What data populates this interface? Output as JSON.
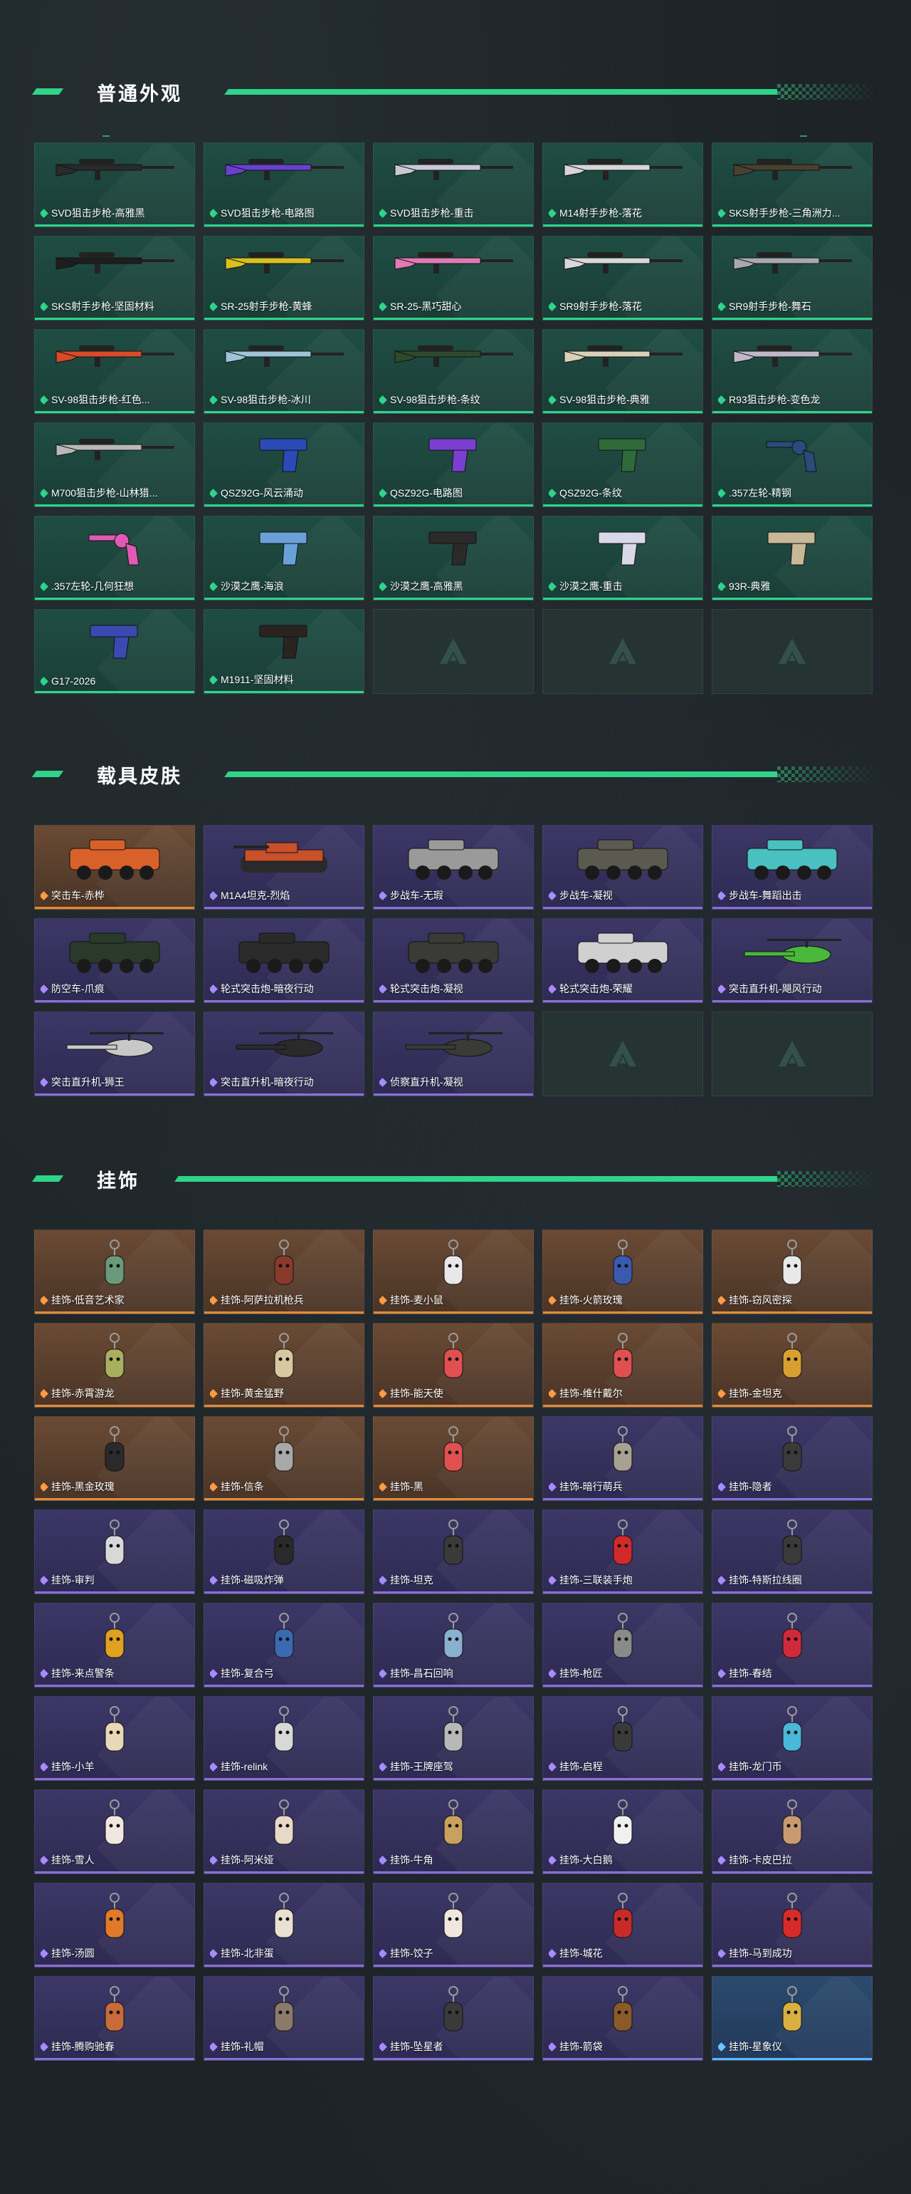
{
  "sections": {
    "weapons": {
      "title": "普通外观",
      "items": [
        {
          "label": "SVD狙击步枪-高雅黑",
          "rarity": "green",
          "kind": "rifle",
          "color": "#2a2a2a"
        },
        {
          "label": "SVD狙击步枪-电路图",
          "rarity": "green",
          "kind": "rifle",
          "color": "#6a3fd0"
        },
        {
          "label": "SVD狙击步枪-重击",
          "rarity": "green",
          "kind": "rifle",
          "color": "#c9c9d6"
        },
        {
          "label": "M14射手步枪-落花",
          "rarity": "green",
          "kind": "rifle",
          "color": "#d6d6d6"
        },
        {
          "label": "SKS射手步枪-三角洲力...",
          "rarity": "green",
          "kind": "rifle",
          "color": "#4a4030"
        },
        {
          "label": "SKS射手步枪-坚固材料",
          "rarity": "green",
          "kind": "rifle",
          "color": "#1e1e1e"
        },
        {
          "label": "SR-25射手步枪-黄蜂",
          "rarity": "green",
          "kind": "rifle",
          "color": "#d8c020"
        },
        {
          "label": "SR-25-黑巧甜心",
          "rarity": "green",
          "kind": "rifle",
          "color": "#e07ab5"
        },
        {
          "label": "SR9射手步枪-落花",
          "rarity": "green",
          "kind": "rifle",
          "color": "#d8d8d8"
        },
        {
          "label": "SR9射手步枪-舞石",
          "rarity": "green",
          "kind": "rifle",
          "color": "#a8a8b0"
        },
        {
          "label": "SV-98狙击步枪-红色...",
          "rarity": "green",
          "kind": "rifle",
          "color": "#d84a2a"
        },
        {
          "label": "SV-98狙击步枪-冰川",
          "rarity": "green",
          "kind": "rifle",
          "color": "#9ec4d8"
        },
        {
          "label": "SV-98狙击步枪-条纹",
          "rarity": "green",
          "kind": "rifle",
          "color": "#2e4a2e"
        },
        {
          "label": "SV-98狙击步枪-典雅",
          "rarity": "green",
          "kind": "rifle",
          "color": "#d8d0b8"
        },
        {
          "label": "R93狙击步枪-变色龙",
          "rarity": "green",
          "kind": "rifle",
          "color": "#c0b8c8"
        },
        {
          "label": "M700狙击步枪-山林猎...",
          "rarity": "green",
          "kind": "rifle",
          "color": "#b8b8b8"
        },
        {
          "label": "QSZ92G-风云涌动",
          "rarity": "green",
          "kind": "pistol",
          "color": "#2a4ab8"
        },
        {
          "label": "QSZ92G-电路图",
          "rarity": "green",
          "kind": "pistol",
          "color": "#7a3fd0"
        },
        {
          "label": "QSZ92G-条纹",
          "rarity": "green",
          "kind": "pistol",
          "color": "#2e6a3a"
        },
        {
          "label": ".357左轮-精钢",
          "rarity": "green",
          "kind": "revolver",
          "color": "#2a4a7a"
        },
        {
          "label": ".357左轮-几何狂想",
          "rarity": "green",
          "kind": "revolver",
          "color": "#e05ab5"
        },
        {
          "label": "沙漠之鹰-海浪",
          "rarity": "green",
          "kind": "pistol",
          "color": "#6aa0d8"
        },
        {
          "label": "沙漠之鹰-高雅黑",
          "rarity": "green",
          "kind": "pistol",
          "color": "#2a2a2a"
        },
        {
          "label": "沙漠之鹰-重击",
          "rarity": "green",
          "kind": "pistol",
          "color": "#d8d8e8"
        },
        {
          "label": "93R-典雅",
          "rarity": "green",
          "kind": "pistol",
          "color": "#c8b898"
        },
        {
          "label": "G17-2026",
          "rarity": "green",
          "kind": "pistol",
          "color": "#3a4ab0"
        },
        {
          "label": "M1911-坚固材料",
          "rarity": "green",
          "kind": "pistol",
          "color": "#2a2420"
        },
        {
          "label": "",
          "rarity": "empty",
          "kind": "none",
          "color": ""
        },
        {
          "label": "",
          "rarity": "empty",
          "kind": "none",
          "color": ""
        },
        {
          "label": "",
          "rarity": "empty",
          "kind": "none",
          "color": ""
        }
      ]
    },
    "vehicles": {
      "title": "载具皮肤",
      "items": [
        {
          "label": "突击车-赤桦",
          "rarity": "orange",
          "kind": "truck",
          "color": "#d8602a"
        },
        {
          "label": "M1A4坦克-烈焰",
          "rarity": "purple",
          "kind": "tank",
          "color": "#c8502a"
        },
        {
          "label": "步战车-无瑕",
          "rarity": "purple",
          "kind": "apc",
          "color": "#9a9a9a"
        },
        {
          "label": "步战车-凝视",
          "rarity": "purple",
          "kind": "apc",
          "color": "#5a5a50"
        },
        {
          "label": "步战车-舞蹈出击",
          "rarity": "purple",
          "kind": "apc",
          "color": "#4ac0c0"
        },
        {
          "label": "防空车-爪痕",
          "rarity": "purple",
          "kind": "apc",
          "color": "#2a3a2a"
        },
        {
          "label": "轮式突击炮-暗夜行动",
          "rarity": "purple",
          "kind": "truck",
          "color": "#2a2a2a"
        },
        {
          "label": "轮式突击炮-凝视",
          "rarity": "purple",
          "kind": "truck",
          "color": "#3a3a36"
        },
        {
          "label": "轮式突击炮-荣耀",
          "rarity": "purple",
          "kind": "truck",
          "color": "#d0d0d0"
        },
        {
          "label": "突击直升机-飓风行动",
          "rarity": "purple",
          "kind": "heli",
          "color": "#4ab83a"
        },
        {
          "label": "突击直升机-狮王",
          "rarity": "purple",
          "kind": "heli",
          "color": "#c8c8c8"
        },
        {
          "label": "突击直升机-暗夜行动",
          "rarity": "purple",
          "kind": "heli",
          "color": "#2a2a2a"
        },
        {
          "label": "侦察直升机-凝视",
          "rarity": "purple",
          "kind": "heli",
          "color": "#3a3a36"
        },
        {
          "label": "",
          "rarity": "empty",
          "kind": "none",
          "color": ""
        },
        {
          "label": "",
          "rarity": "empty",
          "kind": "none",
          "color": ""
        }
      ]
    },
    "charms": {
      "title": "挂饰",
      "items": [
        {
          "label": "挂饰-低音艺术家",
          "rarity": "orange",
          "kind": "charm",
          "color": "#6a9a7a"
        },
        {
          "label": "挂饰-阿萨拉机枪兵",
          "rarity": "orange",
          "kind": "charm",
          "color": "#8a3a2a"
        },
        {
          "label": "挂饰-麦小鼠",
          "rarity": "orange",
          "kind": "charm",
          "color": "#e8e8e8"
        },
        {
          "label": "挂饰-火箭玫瑰",
          "rarity": "orange",
          "kind": "charm",
          "color": "#3a5ab0"
        },
        {
          "label": "挂饰-窃风密探",
          "rarity": "orange",
          "kind": "charm",
          "color": "#e8e8e8"
        },
        {
          "label": "挂饰-赤霄游龙",
          "rarity": "orange",
          "kind": "charm",
          "color": "#a8b060"
        },
        {
          "label": "挂饰-黄金猛野",
          "rarity": "orange",
          "kind": "charm",
          "color": "#d8c8a0"
        },
        {
          "label": "挂饰-能天使",
          "rarity": "orange",
          "kind": "charm",
          "color": "#e05050"
        },
        {
          "label": "挂饰-维什戴尔",
          "rarity": "orange",
          "kind": "charm",
          "color": "#e05050"
        },
        {
          "label": "挂饰-金坦克",
          "rarity": "orange",
          "kind": "charm",
          "color": "#d8a030"
        },
        {
          "label": "挂饰-黑金玫瑰",
          "rarity": "orange",
          "kind": "charm",
          "color": "#2a2a2a"
        },
        {
          "label": "挂饰-信条",
          "rarity": "orange",
          "kind": "charm",
          "color": "#a8a8a8"
        },
        {
          "label": "挂饰-黑",
          "rarity": "orange",
          "kind": "charm",
          "color": "#e05050"
        },
        {
          "label": "挂饰-暗行萌兵",
          "rarity": "purple",
          "kind": "charm",
          "color": "#a8a090"
        },
        {
          "label": "挂饰-隐者",
          "rarity": "purple",
          "kind": "charm",
          "color": "#3a3a3a"
        },
        {
          "label": "挂饰-审判",
          "rarity": "purple",
          "kind": "charm",
          "color": "#d8d8d8"
        },
        {
          "label": "挂饰-磁吸炸弹",
          "rarity": "purple",
          "kind": "charm",
          "color": "#2a2a2a"
        },
        {
          "label": "挂饰-坦克",
          "rarity": "purple",
          "kind": "charm",
          "color": "#3a3a3a"
        },
        {
          "label": "挂饰-三联装手炮",
          "rarity": "purple",
          "kind": "charm",
          "color": "#d02a2a"
        },
        {
          "label": "挂饰-特斯拉线圈",
          "rarity": "purple",
          "kind": "charm",
          "color": "#3a3a3a"
        },
        {
          "label": "挂饰-来点警条",
          "rarity": "purple",
          "kind": "charm",
          "color": "#e0a020"
        },
        {
          "label": "挂饰-复合弓",
          "rarity": "purple",
          "kind": "charm",
          "color": "#3a6ab0"
        },
        {
          "label": "挂饰-昌石回响",
          "rarity": "purple",
          "kind": "charm",
          "color": "#8ab0d0"
        },
        {
          "label": "挂饰-枪匠",
          "rarity": "purple",
          "kind": "charm",
          "color": "#8a8a8a"
        },
        {
          "label": "挂饰-春结",
          "rarity": "purple",
          "kind": "charm",
          "color": "#d02a3a"
        },
        {
          "label": "挂饰-小羊",
          "rarity": "purple",
          "kind": "charm",
          "color": "#e8d8b8"
        },
        {
          "label": "挂饰-relink",
          "rarity": "purple",
          "kind": "charm",
          "color": "#d8d8d8"
        },
        {
          "label": "挂饰-王牌座驾",
          "rarity": "purple",
          "kind": "charm",
          "color": "#b8b8b8"
        },
        {
          "label": "挂饰-启程",
          "rarity": "purple",
          "kind": "charm",
          "color": "#3a3a3a"
        },
        {
          "label": "挂饰-龙门币",
          "rarity": "purple",
          "kind": "charm",
          "color": "#4ab8d8"
        },
        {
          "label": "挂饰-雪人",
          "rarity": "purple",
          "kind": "charm",
          "color": "#f0e8e0"
        },
        {
          "label": "挂饰-阿米娅",
          "rarity": "purple",
          "kind": "charm",
          "color": "#e8d8c8"
        },
        {
          "label": "挂饰-牛角",
          "rarity": "purple",
          "kind": "charm",
          "color": "#c8a060"
        },
        {
          "label": "挂饰-大白鹅",
          "rarity": "purple",
          "kind": "charm",
          "color": "#f0f0f0"
        },
        {
          "label": "挂饰-卡皮巴拉",
          "rarity": "purple",
          "kind": "charm",
          "color": "#c89a70"
        },
        {
          "label": "挂饰-汤圆",
          "rarity": "purple",
          "kind": "charm",
          "color": "#e07a2a"
        },
        {
          "label": "挂饰-北非蛋",
          "rarity": "purple",
          "kind": "charm",
          "color": "#e8e0d0"
        },
        {
          "label": "挂饰-饺子",
          "rarity": "purple",
          "kind": "charm",
          "color": "#f0e8e0"
        },
        {
          "label": "挂饰-城花",
          "rarity": "purple",
          "kind": "charm",
          "color": "#c82a2a"
        },
        {
          "label": "挂饰-马到成功",
          "rarity": "purple",
          "kind": "charm",
          "color": "#d82a2a"
        },
        {
          "label": "挂饰-腾购驰春",
          "rarity": "purple",
          "kind": "charm",
          "color": "#c86a3a"
        },
        {
          "label": "挂饰-礼帽",
          "rarity": "purple",
          "kind": "charm",
          "color": "#8a7a6a"
        },
        {
          "label": "挂饰-坠星者",
          "rarity": "purple",
          "kind": "charm",
          "color": "#3a3a3a"
        },
        {
          "label": "挂饰-箭袋",
          "rarity": "purple",
          "kind": "charm",
          "color": "#8a5a2a"
        },
        {
          "label": "挂饰-星象仪",
          "rarity": "blue",
          "kind": "charm",
          "color": "#d8b040"
        }
      ]
    }
  }
}
